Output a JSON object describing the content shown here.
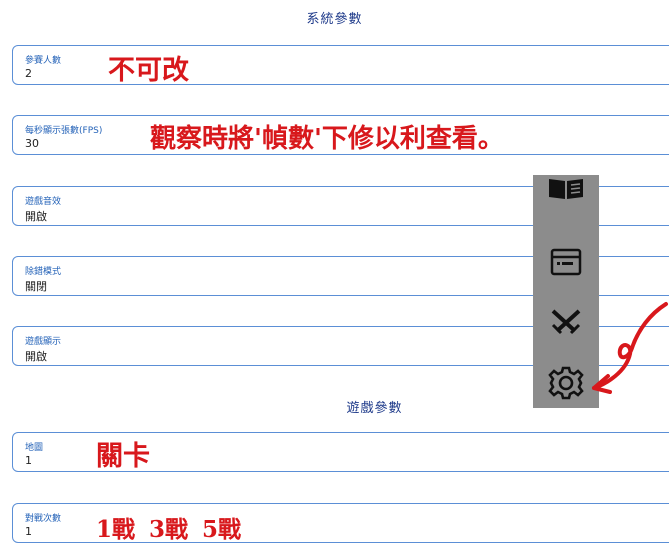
{
  "sections": {
    "system": "系統參數",
    "game": "遊戲參數"
  },
  "fields": {
    "players": {
      "label": "參賽人數",
      "value": "2"
    },
    "fps": {
      "label": "每秒顯示張數(FPS)",
      "value": "30"
    },
    "sound": {
      "label": "遊戲音效",
      "value": "開啟"
    },
    "debug": {
      "label": "除錯模式",
      "value": "關閉"
    },
    "display": {
      "label": "遊戲顯示",
      "value": "開啟"
    },
    "map": {
      "label": "地圖",
      "value": "1"
    },
    "rounds": {
      "label": "對戰次數",
      "value": "1"
    }
  },
  "annotations": {
    "players": "不可改",
    "fps": "觀察時將'幀數'下修以利查看。",
    "map": "關卡",
    "rounds": "1戰 3戰 5戰"
  },
  "sidebar": {
    "icons": [
      "book-icon",
      "window-icon",
      "crossed-swords-icon",
      "gear-icon"
    ]
  },
  "colors": {
    "accent": "#5b8fd6",
    "label": "#2563b8",
    "annotation": "#d8181c",
    "sidebar": "#8c8c8c"
  }
}
